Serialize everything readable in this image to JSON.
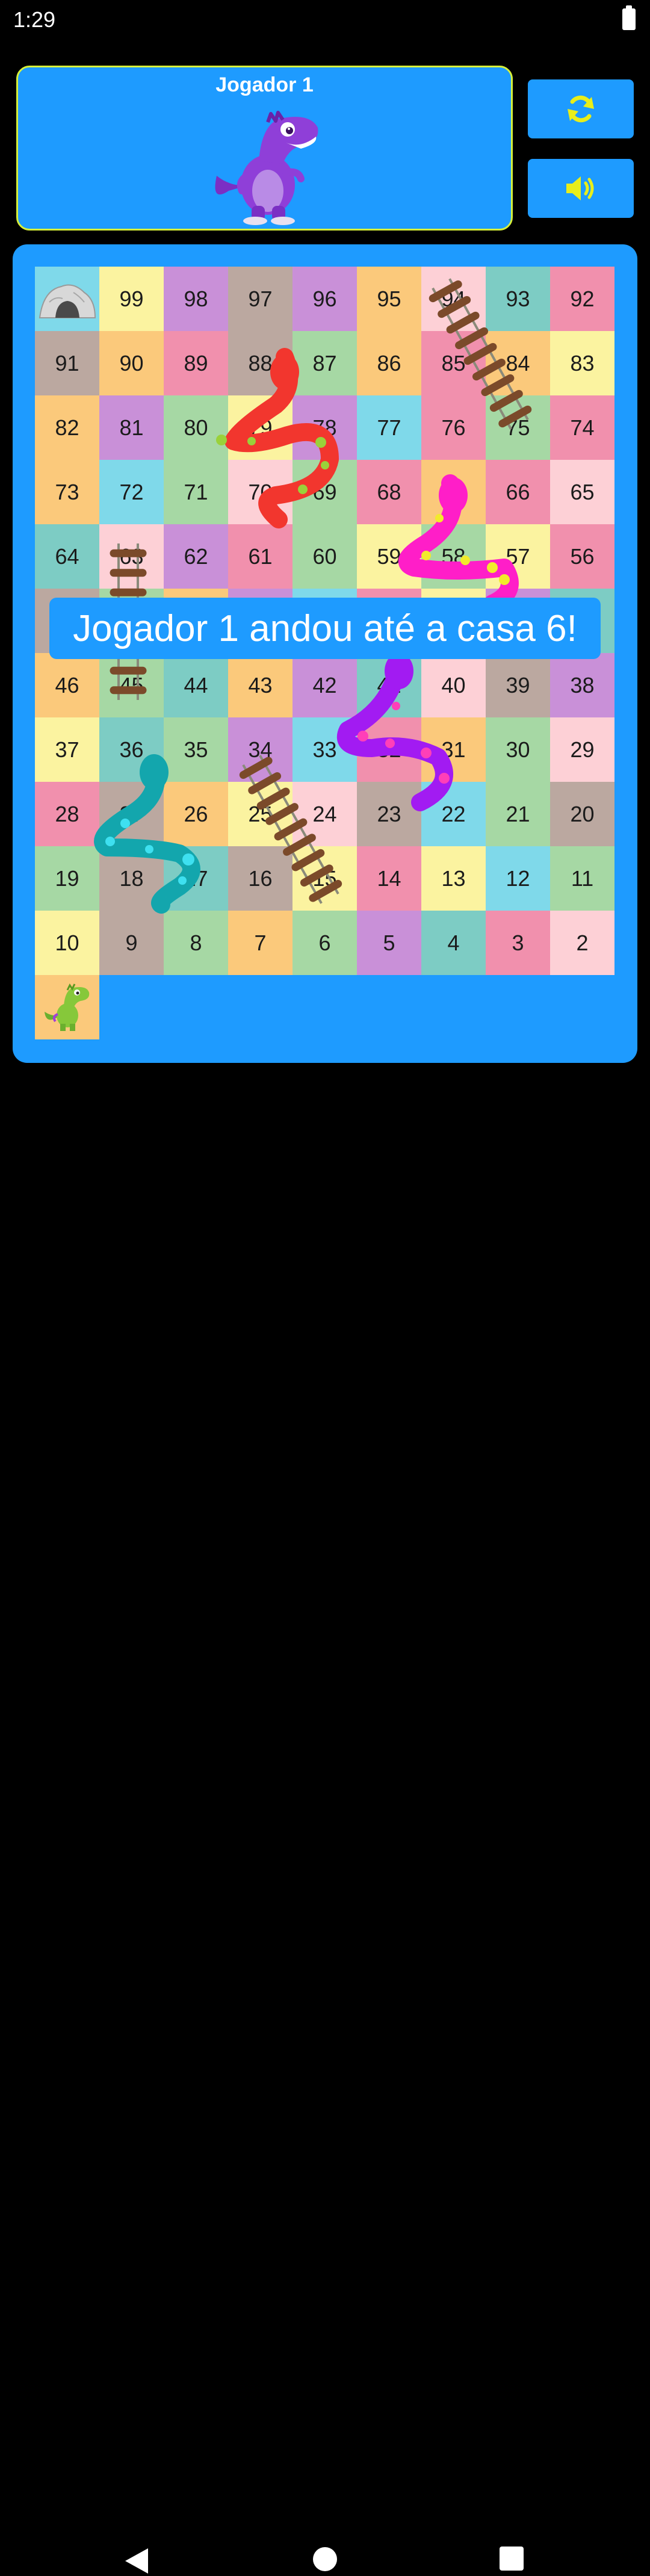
{
  "status_bar": {
    "time": "1:29"
  },
  "player_panel": {
    "title": "Jogador 1",
    "avatar": "purple-dinosaur"
  },
  "controls": [
    {
      "name": "restart",
      "icon": "refresh-icon"
    },
    {
      "name": "sound",
      "icon": "volume-icon"
    }
  ],
  "colors": {
    "accent": "#1e9bff",
    "panel_border": "#d6f03a",
    "icon_yellow": "#e8ee1a",
    "snake_red": "#f2362e",
    "snake_pink": "#ff1ec8",
    "snake_purple": "#a21bf2",
    "snake_teal": "#13a6ad",
    "ladder": "#7b4a2a"
  },
  "board": {
    "rows": [
      [
        {
          "label": "",
          "color": "#7fd9ea",
          "icon": "cave-icon"
        },
        {
          "label": "99",
          "color": "#fbf3a0"
        },
        {
          "label": "98",
          "color": "#c990d8"
        },
        {
          "label": "97",
          "color": "#bba8a0"
        },
        {
          "label": "96",
          "color": "#c990d8"
        },
        {
          "label": "95",
          "color": "#fbc97b"
        },
        {
          "label": "94",
          "color": "#fdd0d6"
        },
        {
          "label": "93",
          "color": "#7dccc4"
        },
        {
          "label": "92",
          "color": "#f190ad"
        }
      ],
      [
        {
          "label": "91",
          "color": "#bba8a0"
        },
        {
          "label": "90",
          "color": "#fbc97b"
        },
        {
          "label": "89",
          "color": "#f190ad"
        },
        {
          "label": "88",
          "color": "#bba8a0"
        },
        {
          "label": "87",
          "color": "#a6d8a4"
        },
        {
          "label": "86",
          "color": "#fbc97b"
        },
        {
          "label": "85",
          "color": "#f190ad"
        },
        {
          "label": "84",
          "color": "#fbc97b"
        },
        {
          "label": "83",
          "color": "#fbf3a0"
        }
      ],
      [
        {
          "label": "82",
          "color": "#fbc97b"
        },
        {
          "label": "81",
          "color": "#c990d8"
        },
        {
          "label": "80",
          "color": "#a6d8a4"
        },
        {
          "label": "79",
          "color": "#fbf3a0"
        },
        {
          "label": "78",
          "color": "#c990d8"
        },
        {
          "label": "77",
          "color": "#7fd9ea"
        },
        {
          "label": "76",
          "color": "#f190ad"
        },
        {
          "label": "75",
          "color": "#a6d8a4"
        },
        {
          "label": "74",
          "color": "#f190ad"
        }
      ],
      [
        {
          "label": "73",
          "color": "#fbc97b"
        },
        {
          "label": "72",
          "color": "#7fd9ea"
        },
        {
          "label": "71",
          "color": "#a6d8a4"
        },
        {
          "label": "70",
          "color": "#fdd0d6"
        },
        {
          "label": "69",
          "color": "#a6d8a4"
        },
        {
          "label": "68",
          "color": "#f190ad"
        },
        {
          "label": "67",
          "color": "#fbc97b"
        },
        {
          "label": "66",
          "color": "#f190ad"
        },
        {
          "label": "65",
          "color": "#fdd0d6"
        }
      ],
      [
        {
          "label": "64",
          "color": "#7dccc4"
        },
        {
          "label": "63",
          "color": "#fdd0d6"
        },
        {
          "label": "62",
          "color": "#c990d8"
        },
        {
          "label": "61",
          "color": "#f190ad"
        },
        {
          "label": "60",
          "color": "#a6d8a4"
        },
        {
          "label": "59",
          "color": "#fbf3a0"
        },
        {
          "label": "58",
          "color": "#a6d8a4"
        },
        {
          "label": "57",
          "color": "#fbf3a0"
        },
        {
          "label": "56",
          "color": "#f190ad"
        }
      ],
      [
        {
          "label": "",
          "color": "#bba8a0"
        },
        {
          "label": "",
          "color": "#a6d8a4"
        },
        {
          "label": "",
          "color": "#fbc97b"
        },
        {
          "label": "",
          "color": "#c990d8"
        },
        {
          "label": "",
          "color": "#7fd9ea"
        },
        {
          "label": "",
          "color": "#f190ad"
        },
        {
          "label": "",
          "color": "#fbf3a0"
        },
        {
          "label": "",
          "color": "#c990d8"
        },
        {
          "label": "",
          "color": "#7dccc4"
        }
      ],
      [
        {
          "label": "46",
          "color": "#fbc97b"
        },
        {
          "label": "45",
          "color": "#a6d8a4"
        },
        {
          "label": "44",
          "color": "#7dccc4"
        },
        {
          "label": "43",
          "color": "#fbc97b"
        },
        {
          "label": "42",
          "color": "#c990d8"
        },
        {
          "label": "41",
          "color": "#7dccc4"
        },
        {
          "label": "40",
          "color": "#fdd0d6"
        },
        {
          "label": "39",
          "color": "#bba8a0"
        },
        {
          "label": "38",
          "color": "#c990d8"
        }
      ],
      [
        {
          "label": "37",
          "color": "#fbf3a0"
        },
        {
          "label": "36",
          "color": "#7dccc4"
        },
        {
          "label": "35",
          "color": "#a6d8a4"
        },
        {
          "label": "34",
          "color": "#c990d8"
        },
        {
          "label": "33",
          "color": "#7fd9ea"
        },
        {
          "label": "32",
          "color": "#f190ad"
        },
        {
          "label": "31",
          "color": "#fbc97b"
        },
        {
          "label": "30",
          "color": "#a6d8a4"
        },
        {
          "label": "29",
          "color": "#fdd0d6"
        }
      ],
      [
        {
          "label": "28",
          "color": "#f190ad"
        },
        {
          "label": "27",
          "color": "#bba8a0"
        },
        {
          "label": "26",
          "color": "#fbc97b"
        },
        {
          "label": "25",
          "color": "#fbf3a0"
        },
        {
          "label": "24",
          "color": "#fdd0d6"
        },
        {
          "label": "23",
          "color": "#bba8a0"
        },
        {
          "label": "22",
          "color": "#7fd9ea"
        },
        {
          "label": "21",
          "color": "#a6d8a4"
        },
        {
          "label": "20",
          "color": "#bba8a0"
        }
      ],
      [
        {
          "label": "19",
          "color": "#a6d8a4"
        },
        {
          "label": "18",
          "color": "#bba8a0"
        },
        {
          "label": "17",
          "color": "#7dccc4"
        },
        {
          "label": "16",
          "color": "#bba8a0"
        },
        {
          "label": "15",
          "color": "#fbf3a0"
        },
        {
          "label": "14",
          "color": "#f190ad"
        },
        {
          "label": "13",
          "color": "#fbf3a0"
        },
        {
          "label": "12",
          "color": "#7fd9ea"
        },
        {
          "label": "11",
          "color": "#a6d8a4"
        }
      ],
      [
        {
          "label": "10",
          "color": "#fbf3a0"
        },
        {
          "label": "9",
          "color": "#bba8a0"
        },
        {
          "label": "8",
          "color": "#a6d8a4"
        },
        {
          "label": "7",
          "color": "#fbc97b"
        },
        {
          "label": "6",
          "color": "#a6d8a4"
        },
        {
          "label": "5",
          "color": "#c990d8"
        },
        {
          "label": "4",
          "color": "#7dccc4"
        },
        {
          "label": "3",
          "color": "#f190ad"
        },
        {
          "label": "2",
          "color": "#fdd0d6"
        }
      ],
      [
        {
          "label": "",
          "color": "#fbc97b",
          "icon": "green-dinosaur-token"
        }
      ]
    ]
  },
  "message": "Jogador 1 andou até a casa 6!",
  "nav": {
    "back": "back-icon",
    "home": "home-icon",
    "recents": "recents-icon"
  }
}
